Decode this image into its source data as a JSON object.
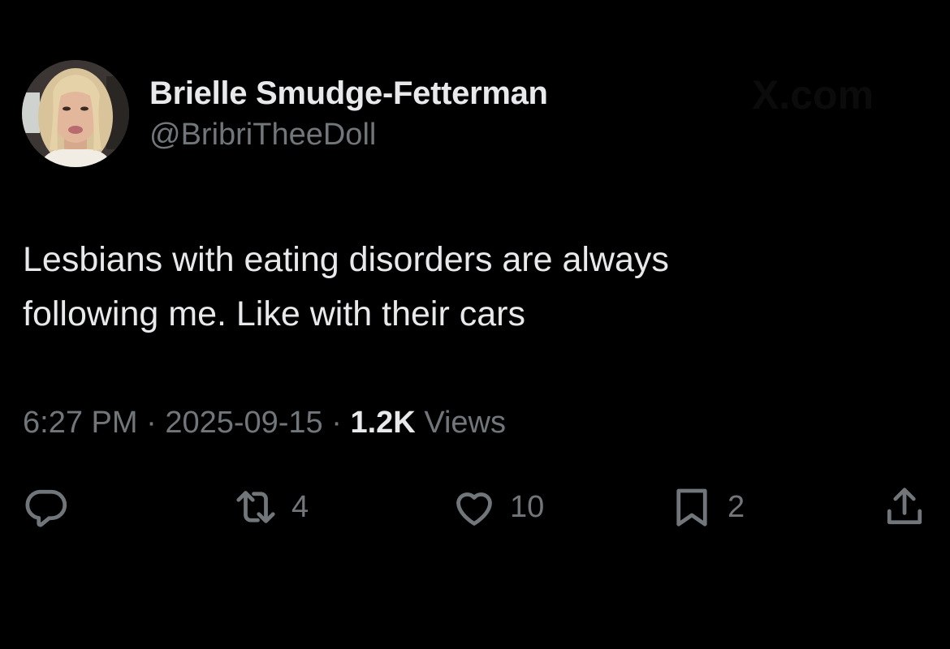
{
  "author": {
    "display_name": "Brielle Smudge-Fetterman",
    "handle": "@BribriTheeDoll"
  },
  "watermark": "X.com",
  "tweet": {
    "lines": [
      "Lesbians with eating disorders are always",
      "following me. Like with their cars"
    ]
  },
  "meta": {
    "time": "6:27 PM",
    "separator": " · ",
    "date": "2025-09-15",
    "views_count": "1.2K",
    "views_label": " Views"
  },
  "actions": {
    "reply": {
      "icon": "reply-icon",
      "count": ""
    },
    "retweet": {
      "icon": "retweet-icon",
      "count": "4"
    },
    "like": {
      "icon": "heart-icon",
      "count": "10"
    },
    "bookmark": {
      "icon": "bookmark-icon",
      "count": "2"
    },
    "share": {
      "icon": "share-icon",
      "count": ""
    }
  },
  "colors": {
    "background": "#000000",
    "primary_text": "#e7e9ea",
    "secondary_text": "#71767b"
  }
}
